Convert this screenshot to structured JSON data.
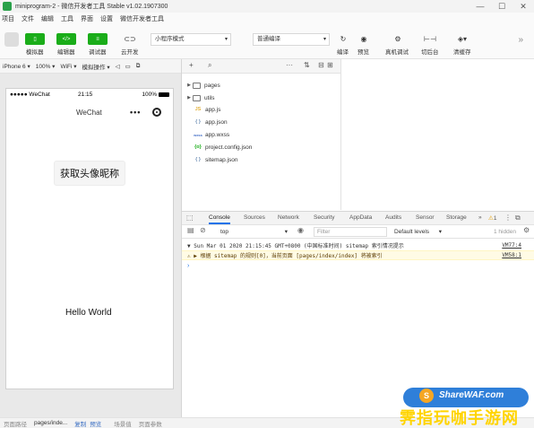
{
  "window": {
    "title": "miniprogram-2 - 微信开发者工具 Stable v1.02.1907300",
    "controls": [
      "—",
      "☐",
      "✕"
    ]
  },
  "menu": [
    "项目",
    "文件",
    "编辑",
    "工具",
    "界面",
    "设置",
    "微信开发者工具"
  ],
  "toolbar": {
    "simulator_label": "模拟器",
    "editor_label": "编辑器",
    "debugger_label": "调试器",
    "cloud_label": "云开发",
    "mode_select": "小程序模式",
    "compile_select": "普通编译",
    "compile_label": "编译",
    "preview_label": "预览",
    "remote_debug_label": "真机调试",
    "backend_label": "切后台",
    "clear_cache_label": "清缓存"
  },
  "simulator": {
    "device": "iPhone 6",
    "zoom": "100%",
    "network": "WiFi",
    "operation": "模拟操作",
    "status_left": "●●●●● WeChat",
    "status_time": "21:15",
    "status_right": "100%",
    "nav_title": "WeChat",
    "capsule_dots": "•••",
    "button_text": "获取头像昵称",
    "hello_text": "Hello World"
  },
  "file_tree": [
    {
      "name": "pages",
      "type": "folder",
      "icon": ""
    },
    {
      "name": "utils",
      "type": "folder",
      "icon": ""
    },
    {
      "name": "app.js",
      "type": "file",
      "icon": "JS",
      "color": "#e3b341"
    },
    {
      "name": "app.json",
      "type": "file",
      "icon": "{ }",
      "color": "#6e8fb5"
    },
    {
      "name": "app.wxss",
      "type": "file",
      "icon": "wxss",
      "color": "#4a74c9"
    },
    {
      "name": "project.config.json",
      "type": "file",
      "icon": "{o}",
      "color": "#1aad19"
    },
    {
      "name": "sitemap.json",
      "type": "file",
      "icon": "{ }",
      "color": "#6e8fb5"
    }
  ],
  "devtools": {
    "tabs": [
      "Console",
      "Sources",
      "Network",
      "Security",
      "AppData",
      "Audits",
      "Sensor",
      "Storage"
    ],
    "more": "»",
    "warn_count": "1",
    "context": "top",
    "filter_placeholder": "Filter",
    "levels": "Default levels",
    "hidden": "1 hidden"
  },
  "console": {
    "log1_text": "▼ Sun Mar 01 2020 21:15:45 GMT+0800 (中国标准时间) sitemap 索引情况提示",
    "log1_src": "VM77:4",
    "log2_text": "⚠ ▶ 根据 sitemap 的规则[0]，当前页面 [pages/index/index] 将被索引",
    "log2_src": "VM58:1",
    "prompt": "›"
  },
  "bottom_bar": {
    "path_label": "页面路径",
    "path_value": "pages/inde...",
    "copy": "复制",
    "preview": "预览",
    "scene": "场景值",
    "params": "页面参数"
  },
  "watermark": {
    "logo": "S",
    "site": "ShareWAF.com",
    "cn": "霁指玩咖手游网"
  }
}
